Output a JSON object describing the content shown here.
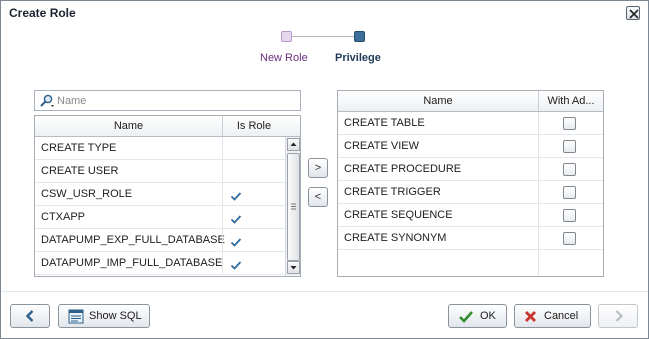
{
  "dialog": {
    "title": "Create Role"
  },
  "train": {
    "steps": [
      "New Role",
      "Privilege"
    ]
  },
  "search": {
    "placeholder": "Name"
  },
  "available": {
    "columns": [
      "Name",
      "Is Role"
    ],
    "rows": [
      {
        "name": "CREATE TYPE",
        "is_role": false
      },
      {
        "name": "CREATE USER",
        "is_role": false
      },
      {
        "name": "CSW_USR_ROLE",
        "is_role": true
      },
      {
        "name": "CTXAPP",
        "is_role": true
      },
      {
        "name": "DATAPUMP_EXP_FULL_DATABASE",
        "is_role": true
      },
      {
        "name": "DATAPUMP_IMP_FULL_DATABASE",
        "is_role": true
      }
    ]
  },
  "shuttle": {
    "move_right": ">",
    "move_left": "<"
  },
  "selected": {
    "columns": [
      "Name",
      "With Ad..."
    ],
    "rows": [
      {
        "name": "CREATE TABLE",
        "with_admin": false
      },
      {
        "name": "CREATE VIEW",
        "with_admin": false
      },
      {
        "name": "CREATE PROCEDURE",
        "with_admin": false
      },
      {
        "name": "CREATE TRIGGER",
        "with_admin": false
      },
      {
        "name": "CREATE SEQUENCE",
        "with_admin": false
      },
      {
        "name": "CREATE SYNONYM",
        "with_admin": false
      }
    ]
  },
  "footer": {
    "show_sql": "Show SQL",
    "ok": "OK",
    "cancel": "Cancel"
  },
  "colors": {
    "accent": "#2c5f8a",
    "check": "#2e6a9e",
    "ok_icon": "#2f8f2f",
    "cancel_icon": "#c8352b"
  }
}
